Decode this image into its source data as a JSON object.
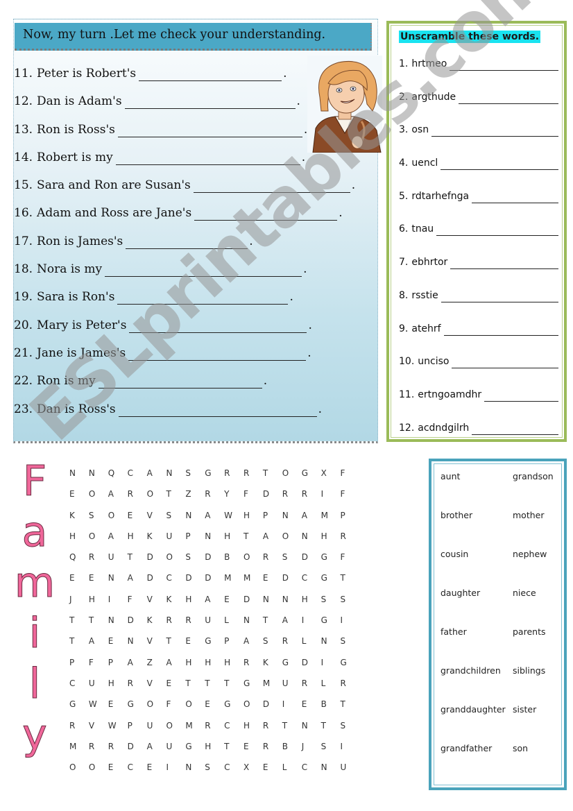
{
  "header": {
    "title": "Now, my turn .Let me check your understanding."
  },
  "sentences": [
    {
      "number": "11.",
      "text": "Peter is Robert's",
      "period": "."
    },
    {
      "number": "12.",
      "text": "Dan is Adam's",
      "period": "."
    },
    {
      "number": "13.",
      "text": "Ron is Ross's",
      "period": "."
    },
    {
      "number": "14.",
      "text": "Robert is my",
      "period": "."
    },
    {
      "number": "15.",
      "text": "Sara and Ron are Susan's",
      "period": "."
    },
    {
      "number": "16.",
      "text": "Adam and Ross are Jane's",
      "period": "."
    },
    {
      "number": "17.",
      "text": "Ron is James's",
      "period": "."
    },
    {
      "number": "18.",
      "text": "Nora is my",
      "period": "."
    },
    {
      "number": "19.",
      "text": "Sara is Ron's",
      "period": "."
    },
    {
      "number": "20.",
      "text": "Mary is Peter's",
      "period": "."
    },
    {
      "number": "21.",
      "text": "Jane is James's",
      "period": "."
    },
    {
      "number": "22.",
      "text": "Ron is my",
      "period": "."
    },
    {
      "number": "23.",
      "text": "Dan is Ross's",
      "period": "."
    }
  ],
  "unscramble": {
    "title": "Unscramble these words.",
    "items": [
      {
        "number": "1.",
        "word": "hrtmeo"
      },
      {
        "number": "2.",
        "word": "argthude"
      },
      {
        "number": "3.",
        "word": "osn"
      },
      {
        "number": "4.",
        "word": "uencl"
      },
      {
        "number": "5.",
        "word": "rdtarhefnga"
      },
      {
        "number": "6.",
        "word": "tnau"
      },
      {
        "number": "7.",
        "word": "ebhrtor"
      },
      {
        "number": "8.",
        "word": "rsstie"
      },
      {
        "number": "9.",
        "word": "atehrf"
      },
      {
        "number": "10.",
        "word": "unciso"
      },
      {
        "number": "11.",
        "word": "ertngoamdhr"
      },
      {
        "number": "12.",
        "word": "acdndgilrh"
      }
    ]
  },
  "wordsearch": {
    "title_letters": [
      "F",
      "a",
      "m",
      "i",
      "l",
      "y"
    ],
    "grid": [
      [
        "N",
        "N",
        "Q",
        "C",
        "A",
        "N",
        "S",
        "G",
        "R",
        "R",
        "T",
        "O",
        "G",
        "X",
        "F"
      ],
      [
        "E",
        "O",
        "A",
        "R",
        "O",
        "T",
        "Z",
        "R",
        "Y",
        "F",
        "D",
        "R",
        "R",
        "I",
        "F"
      ],
      [
        "K",
        "S",
        "O",
        "E",
        "V",
        "S",
        "N",
        "A",
        "W",
        "H",
        "P",
        "N",
        "A",
        "M",
        "P"
      ],
      [
        "H",
        "O",
        "A",
        "H",
        "K",
        "U",
        "P",
        "N",
        "H",
        "T",
        "A",
        "O",
        "N",
        "H",
        "R"
      ],
      [
        "Q",
        "R",
        "U",
        "T",
        "D",
        "O",
        "S",
        "D",
        "B",
        "O",
        "R",
        "S",
        "D",
        "G",
        "F"
      ],
      [
        "E",
        "E",
        "N",
        "A",
        "D",
        "C",
        "D",
        "D",
        "M",
        "M",
        "E",
        "D",
        "C",
        "G",
        "T"
      ],
      [
        "J",
        "H",
        "I",
        "F",
        "V",
        "K",
        "H",
        "A",
        "E",
        "D",
        "N",
        "N",
        "H",
        "S",
        "S"
      ],
      [
        "T",
        "T",
        "N",
        "D",
        "K",
        "R",
        "R",
        "U",
        "L",
        "N",
        "T",
        "A",
        "I",
        "G",
        "I"
      ],
      [
        "T",
        "A",
        "E",
        "N",
        "V",
        "T",
        "E",
        "G",
        "P",
        "A",
        "S",
        "R",
        "L",
        "N",
        "S"
      ],
      [
        "P",
        "F",
        "P",
        "A",
        "Z",
        "A",
        "H",
        "H",
        "H",
        "R",
        "K",
        "G",
        "D",
        "I",
        "G"
      ],
      [
        "C",
        "U",
        "H",
        "R",
        "V",
        "E",
        "T",
        "T",
        "T",
        "G",
        "M",
        "U",
        "R",
        "L",
        "R"
      ],
      [
        "G",
        "W",
        "E",
        "G",
        "O",
        "F",
        "O",
        "E",
        "G",
        "O",
        "D",
        "I",
        "E",
        "B",
        "T"
      ],
      [
        "R",
        "V",
        "W",
        "P",
        "U",
        "O",
        "M",
        "R",
        "C",
        "H",
        "R",
        "T",
        "N",
        "T",
        "S"
      ],
      [
        "M",
        "R",
        "R",
        "D",
        "A",
        "U",
        "G",
        "H",
        "T",
        "E",
        "R",
        "B",
        "J",
        "S",
        "I"
      ],
      [
        "O",
        "O",
        "E",
        "C",
        "E",
        "I",
        "N",
        "S",
        "C",
        "X",
        "E",
        "L",
        "C",
        "N",
        "U"
      ]
    ],
    "words": [
      "aunt",
      "grandson",
      "brother",
      "mother",
      "cousin",
      "nephew",
      "daughter",
      "niece",
      "father",
      "parents",
      "grandchildren",
      "siblings",
      "granddaughter",
      "sister",
      "grandfather",
      "son"
    ]
  },
  "watermark": {
    "text": "ESLprintables.com"
  },
  "colors": {
    "header_bar": "#4ba8c6",
    "unscramble_border": "#9bbb59",
    "unscramble_title_highlight": "#19e3f0",
    "wordlist_border": "#4aa3bb",
    "family_letters": "#f0679a"
  }
}
